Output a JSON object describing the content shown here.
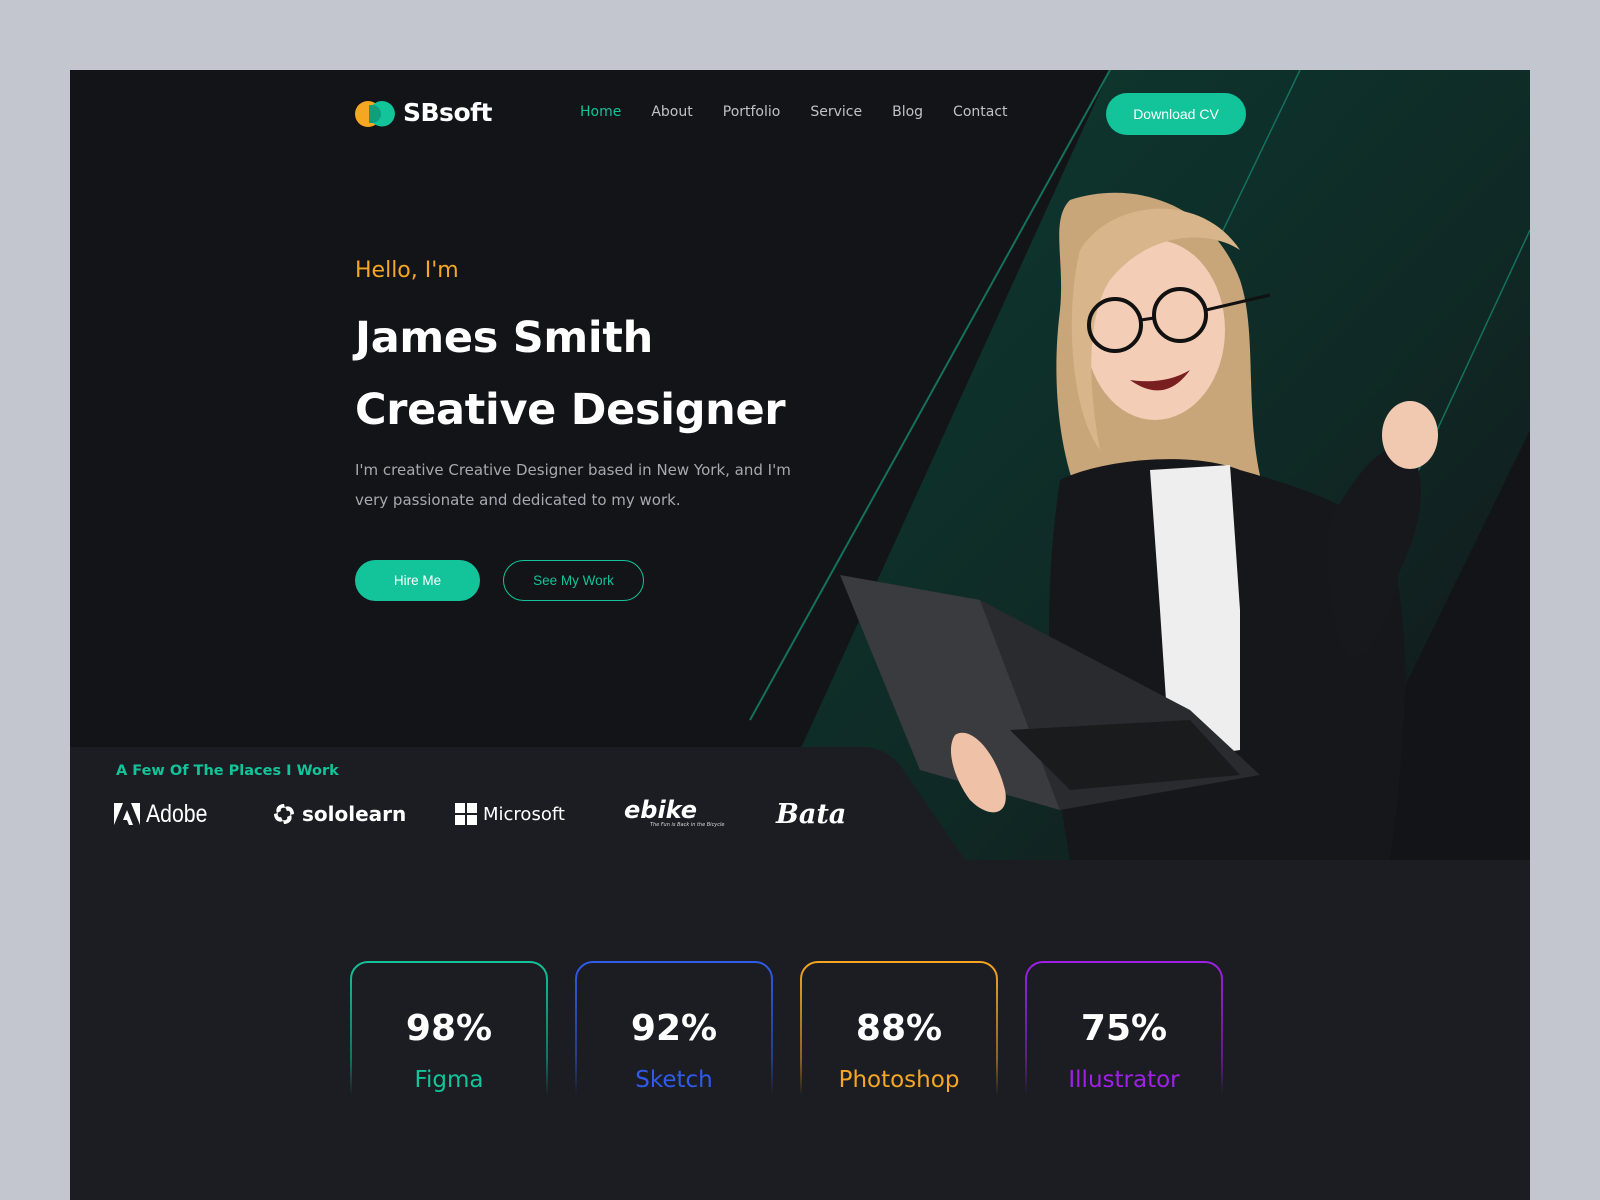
{
  "brand": {
    "name": "SBsoft",
    "logo_icon": "overlapping-circles-logo"
  },
  "nav": {
    "items": [
      {
        "label": "Home",
        "active": true
      },
      {
        "label": "About",
        "active": false
      },
      {
        "label": "Portfolio",
        "active": false
      },
      {
        "label": "Service",
        "active": false
      },
      {
        "label": "Blog",
        "active": false
      },
      {
        "label": "Contact",
        "active": false
      }
    ],
    "cta_label": "Download CV"
  },
  "hero": {
    "greeting": "Hello, I'm",
    "name": "James Smith",
    "role": "Creative Designer",
    "description": "I'm creative Creative Designer based in New York, and I'm very passionate and dedicated to my work.",
    "primary_button": "Hire Me",
    "secondary_button": "See My Work",
    "image_alt": "Smiling woman with glasses holding a laptop"
  },
  "places": {
    "heading": "A Few Of The Places I Work",
    "brands": [
      {
        "name": "Adobe",
        "icon": "adobe-icon"
      },
      {
        "name": "sololearn",
        "icon": "sololearn-icon"
      },
      {
        "name": "Microsoft",
        "icon": "microsoft-icon"
      },
      {
        "name": "ebike",
        "tagline": "The Fun is Back in the Bicycle",
        "icon": "ebike-logo"
      },
      {
        "name": "Bata",
        "icon": "bata-logo"
      }
    ]
  },
  "skills": [
    {
      "percent": "98%",
      "value": 98,
      "name": "Figma",
      "color": "#13c39a"
    },
    {
      "percent": "92%",
      "value": 92,
      "name": "Sketch",
      "color": "#2f5bea"
    },
    {
      "percent": "88%",
      "value": 88,
      "name": "Photoshop",
      "color": "#f5a623"
    },
    {
      "percent": "75%",
      "value": 75,
      "name": "Illustrator",
      "color": "#a020e8"
    }
  ],
  "colors": {
    "accent": "#13c39a",
    "highlight": "#f5a623",
    "background": "#131418",
    "page": "#c3c6cf"
  }
}
